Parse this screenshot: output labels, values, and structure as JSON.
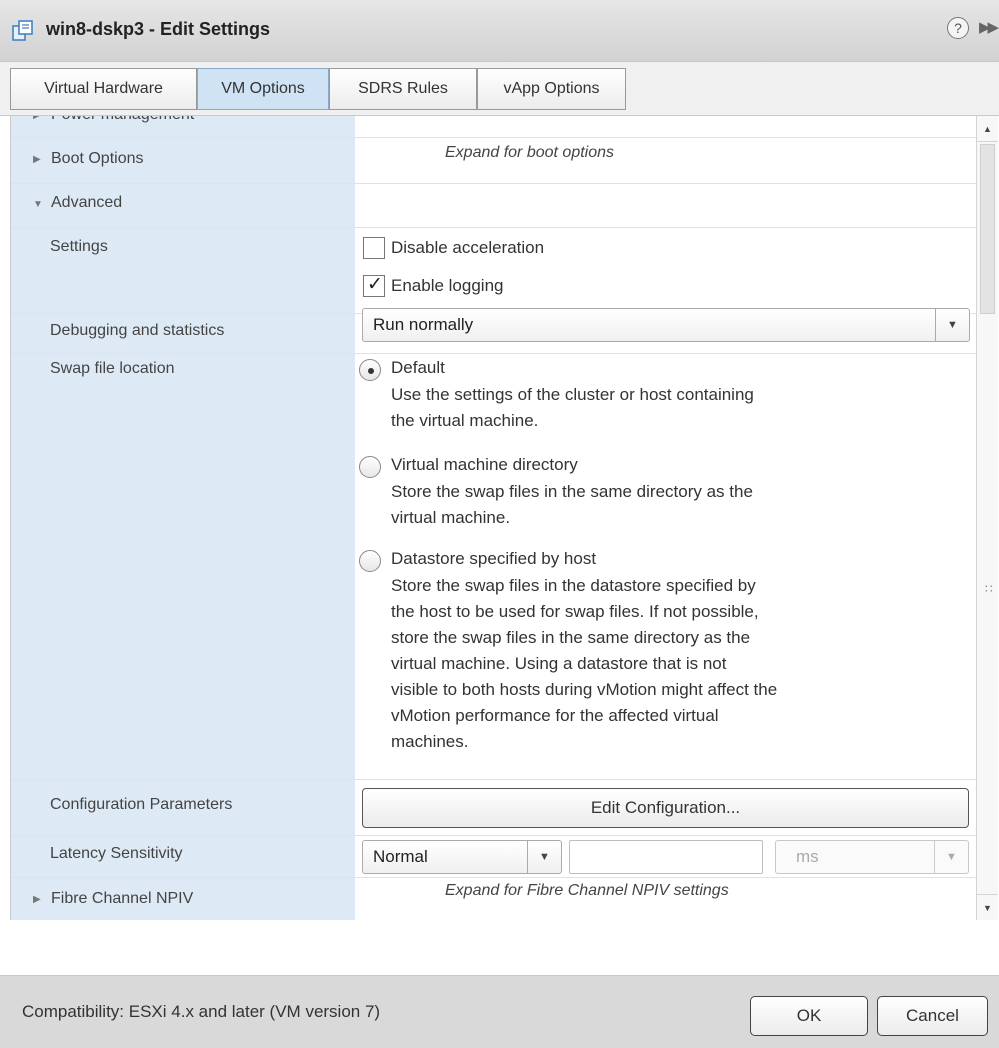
{
  "window": {
    "title": "win8-dskp3 - Edit Settings",
    "help_glyph": "?",
    "expand_glyph": "▶▶"
  },
  "tabs": [
    {
      "label": "Virtual Hardware"
    },
    {
      "label": "VM Options"
    },
    {
      "label": "SDRS Rules"
    },
    {
      "label": "vApp Options"
    }
  ],
  "active_tab": "VM Options",
  "sections": {
    "power_management": {
      "label": "Power management"
    },
    "boot_options": {
      "label": "Boot Options",
      "note": "Expand for boot options"
    },
    "advanced": {
      "label": "Advanced",
      "settings": {
        "label": "Settings",
        "disable_acceleration": {
          "label": "Disable acceleration",
          "checked": false
        },
        "enable_logging": {
          "label": "Enable logging",
          "checked": true
        }
      },
      "debugging": {
        "label": "Debugging and statistics",
        "value": "Run normally"
      },
      "swap": {
        "label": "Swap file location",
        "options": [
          {
            "label": "Default",
            "selected": true,
            "desc": [
              "Use the settings of the cluster or host containing",
              "the virtual machine."
            ]
          },
          {
            "label": "Virtual machine directory",
            "selected": false,
            "desc": [
              "Store the swap files in the same directory as the",
              "virtual machine."
            ]
          },
          {
            "label": "Datastore specified by host",
            "selected": false,
            "desc": [
              "Store the swap files in the datastore specified by",
              "the host to be used for swap files. If not possible,",
              "store the swap files in the same directory as the",
              "virtual machine. Using a datastore that is not",
              "visible to both hosts during vMotion might affect the",
              "vMotion performance for the affected virtual",
              "machines."
            ]
          }
        ]
      },
      "config_params": {
        "label": "Configuration Parameters",
        "button": "Edit Configuration..."
      },
      "latency": {
        "label": "Latency Sensitivity",
        "value": "Normal",
        "unit": "ms"
      }
    },
    "fibre_channel": {
      "label": "Fibre Channel NPIV",
      "note": "Expand for Fibre Channel NPIV settings"
    }
  },
  "footer": {
    "compatibility": "Compatibility: ESXi 4.x and later (VM version 7)",
    "ok": "OK",
    "cancel": "Cancel"
  },
  "colors": {
    "label_column": "#ddeaf6",
    "active_tab": "#cfe3f5",
    "footer": "#d9d9d9",
    "titlebar": "#dcdcdc"
  }
}
